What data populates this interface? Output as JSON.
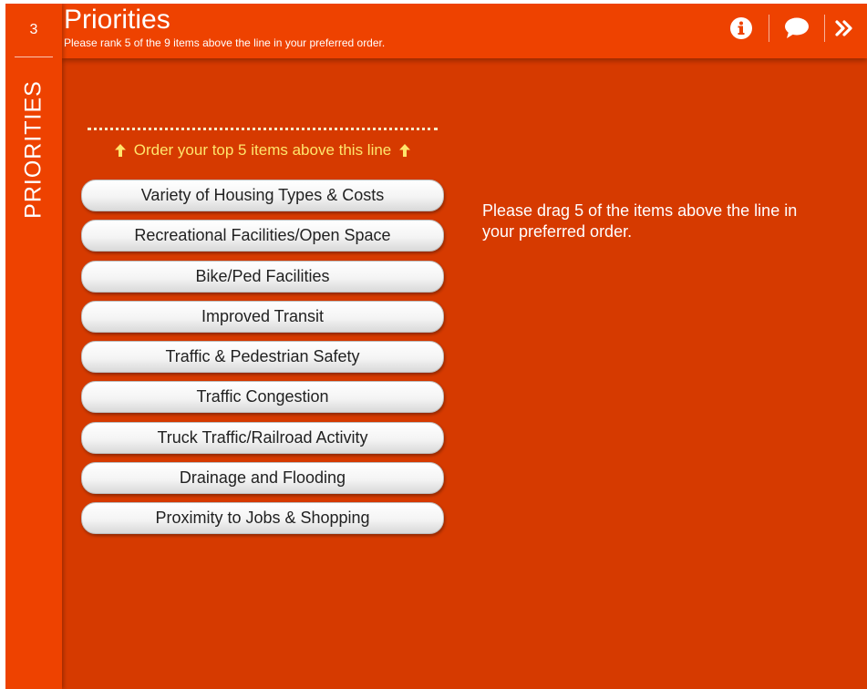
{
  "sidebar": {
    "step_number": "3",
    "label": "PRIORITIES"
  },
  "header": {
    "title": "Priorities",
    "subtitle": "Please rank 5 of the 9 items above the line in your preferred order."
  },
  "toolbar": {
    "info_icon": "info-icon",
    "comment_icon": "speech-bubble-icon",
    "next_icon": "double-chevron-right-icon"
  },
  "rank_line": {
    "label": "Order your top 5 items above this line",
    "arrow_icon": "arrow-up-icon"
  },
  "items": [
    "Variety of Housing Types & Costs",
    "Recreational Facilities/Open Space",
    "Bike/Ped Facilities",
    "Improved Transit",
    "Traffic & Pedestrian Safety",
    "Traffic Congestion",
    "Truck Traffic/Railroad Activity",
    "Drainage and Flooding",
    "Proximity to Jobs & Shopping"
  ],
  "instructions": "Please drag 5 of the items above the line in your preferred order.",
  "colors": {
    "bar_orange": "#ee4200",
    "panel_orange": "#d63a00",
    "line_label_yellow": "#ffe56b",
    "item_text": "#222222"
  }
}
